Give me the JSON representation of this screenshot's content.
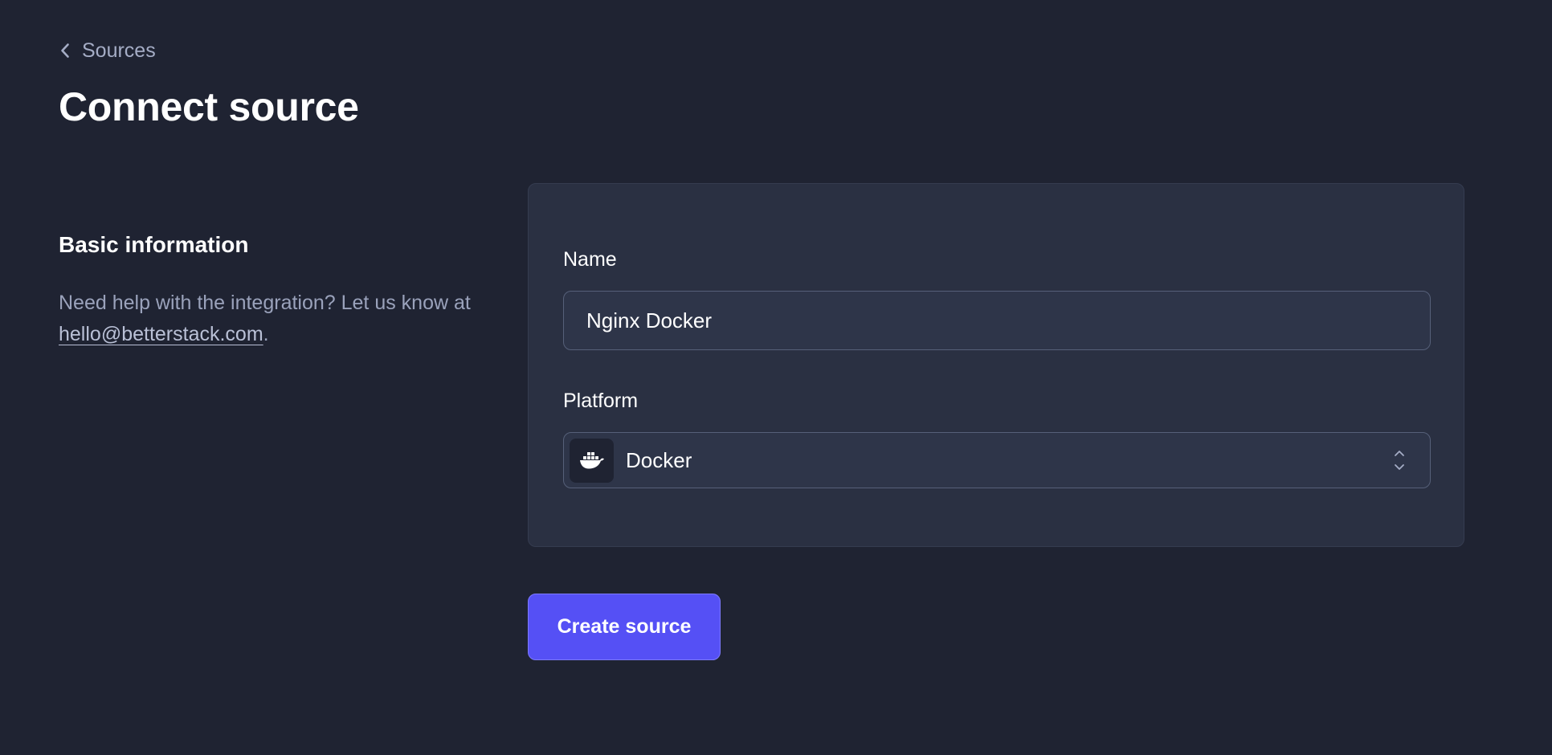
{
  "breadcrumb": {
    "label": "Sources",
    "icon": "chevron-left-icon"
  },
  "page": {
    "title": "Connect source"
  },
  "section": {
    "title": "Basic information",
    "help_prefix": "Need help with the integration? Let us know at ",
    "help_email": "hello@betterstack.com",
    "help_suffix": "."
  },
  "form": {
    "name_label": "Name",
    "name_value": "Nginx Docker",
    "platform_label": "Platform",
    "platform_value": "Docker",
    "platform_icon": "docker-whale-icon",
    "select_icon": "chevron-up-down-icon"
  },
  "actions": {
    "create_label": "Create source"
  },
  "colors": {
    "background": "#1f2332",
    "card": "#2a3042",
    "accent": "#5550f5",
    "muted_text": "#9aa2bb"
  }
}
